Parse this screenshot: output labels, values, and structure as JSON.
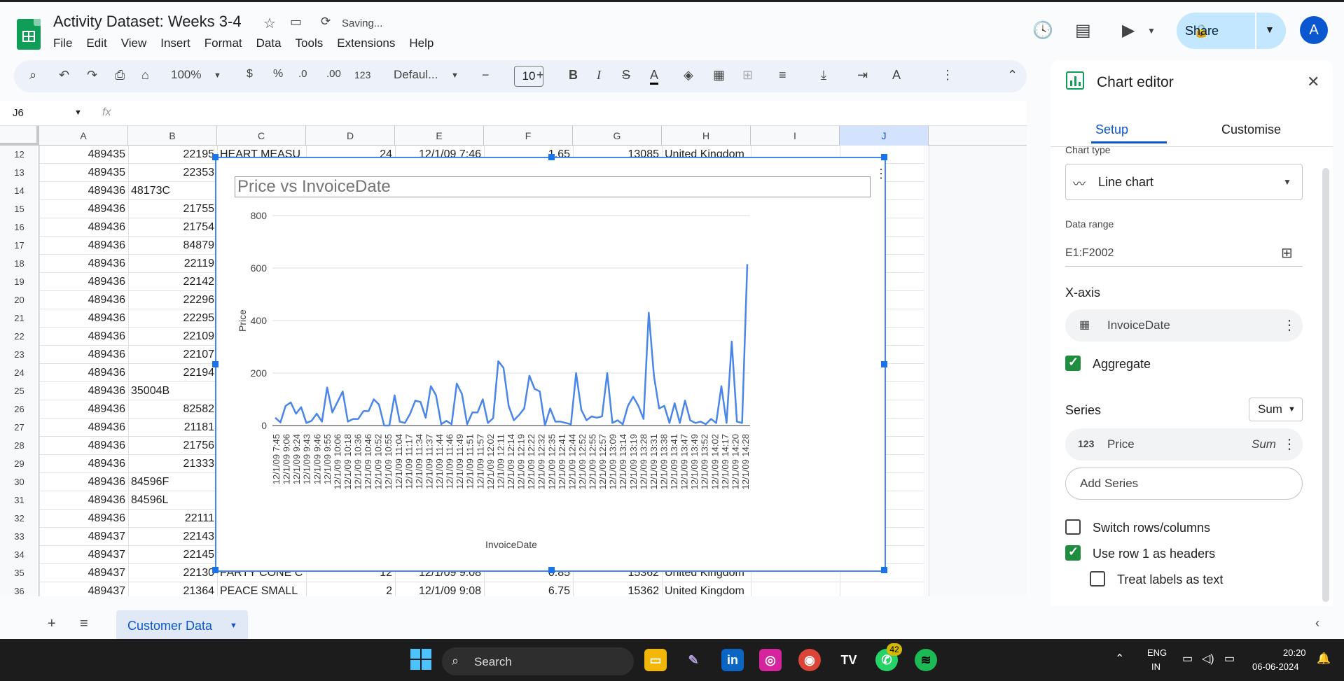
{
  "app": {
    "title": "Activity Dataset: Weeks 3-4",
    "status": "Saving...",
    "menu": [
      "File",
      "Edit",
      "View",
      "Insert",
      "Format",
      "Data",
      "Tools",
      "Extensions",
      "Help"
    ],
    "share_label": "Share",
    "avatar_letter": "A"
  },
  "toolbar": {
    "zoom": "100%",
    "currency": "$",
    "percent": "%",
    "dec_decrease": ".0",
    "dec_increase": ".00",
    "number_format": "123",
    "font": "Defaul...",
    "font_size": "10"
  },
  "formula_bar": {
    "name_box": "J6",
    "fx": "fx"
  },
  "grid": {
    "columns": [
      "A",
      "B",
      "C",
      "D",
      "E",
      "F",
      "G",
      "H",
      "I",
      "J"
    ],
    "rows": [
      {
        "n": "12",
        "a": "489435",
        "b": "22195",
        "c": "HEART MEASU",
        "d": "24",
        "e": "12/1/09 7:46",
        "f": "1.65",
        "g": "13085",
        "h": "United Kingdom"
      },
      {
        "n": "13",
        "a": "489435",
        "b": "22353",
        "c": "",
        "d": "",
        "e": "",
        "f": "",
        "g": "",
        "h": ""
      },
      {
        "n": "14",
        "a": "489436",
        "b": "48173C",
        "c": "",
        "d": "",
        "e": "",
        "f": "",
        "g": "",
        "h": ""
      },
      {
        "n": "15",
        "a": "489436",
        "b": "21755",
        "c": "",
        "d": "",
        "e": "",
        "f": "",
        "g": "",
        "h": ""
      },
      {
        "n": "16",
        "a": "489436",
        "b": "21754",
        "c": "",
        "d": "",
        "e": "",
        "f": "",
        "g": "",
        "h": ""
      },
      {
        "n": "17",
        "a": "489436",
        "b": "84879",
        "c": "",
        "d": "",
        "e": "",
        "f": "",
        "g": "",
        "h": ""
      },
      {
        "n": "18",
        "a": "489436",
        "b": "22119",
        "c": "",
        "d": "",
        "e": "",
        "f": "",
        "g": "",
        "h": ""
      },
      {
        "n": "19",
        "a": "489436",
        "b": "22142",
        "c": "",
        "d": "",
        "e": "",
        "f": "",
        "g": "",
        "h": ""
      },
      {
        "n": "20",
        "a": "489436",
        "b": "22296",
        "c": "",
        "d": "",
        "e": "",
        "f": "",
        "g": "",
        "h": ""
      },
      {
        "n": "21",
        "a": "489436",
        "b": "22295",
        "c": "",
        "d": "",
        "e": "",
        "f": "",
        "g": "",
        "h": ""
      },
      {
        "n": "22",
        "a": "489436",
        "b": "22109",
        "c": "",
        "d": "",
        "e": "",
        "f": "",
        "g": "",
        "h": ""
      },
      {
        "n": "23",
        "a": "489436",
        "b": "22107",
        "c": "",
        "d": "",
        "e": "",
        "f": "",
        "g": "",
        "h": ""
      },
      {
        "n": "24",
        "a": "489436",
        "b": "22194",
        "c": "",
        "d": "",
        "e": "",
        "f": "",
        "g": "",
        "h": ""
      },
      {
        "n": "25",
        "a": "489436",
        "b": "35004B",
        "c": "",
        "d": "",
        "e": "",
        "f": "",
        "g": "",
        "h": ""
      },
      {
        "n": "26",
        "a": "489436",
        "b": "82582",
        "c": "",
        "d": "",
        "e": "",
        "f": "",
        "g": "",
        "h": ""
      },
      {
        "n": "27",
        "a": "489436",
        "b": "21181",
        "c": "",
        "d": "",
        "e": "",
        "f": "",
        "g": "",
        "h": ""
      },
      {
        "n": "28",
        "a": "489436",
        "b": "21756",
        "c": "",
        "d": "",
        "e": "",
        "f": "",
        "g": "",
        "h": ""
      },
      {
        "n": "29",
        "a": "489436",
        "b": "21333",
        "c": "",
        "d": "",
        "e": "",
        "f": "",
        "g": "",
        "h": ""
      },
      {
        "n": "30",
        "a": "489436",
        "b": "84596F",
        "c": "",
        "d": "",
        "e": "",
        "f": "",
        "g": "",
        "h": ""
      },
      {
        "n": "31",
        "a": "489436",
        "b": "84596L",
        "c": "",
        "d": "",
        "e": "",
        "f": "",
        "g": "",
        "h": ""
      },
      {
        "n": "32",
        "a": "489436",
        "b": "22111",
        "c": "",
        "d": "",
        "e": "",
        "f": "",
        "g": "",
        "h": ""
      },
      {
        "n": "33",
        "a": "489437",
        "b": "22143",
        "c": "",
        "d": "",
        "e": "",
        "f": "",
        "g": "",
        "h": ""
      },
      {
        "n": "34",
        "a": "489437",
        "b": "22145",
        "c": "",
        "d": "",
        "e": "",
        "f": "",
        "g": "",
        "h": ""
      },
      {
        "n": "35",
        "a": "489437",
        "b": "22130",
        "c": "PARTY CONE C",
        "d": "12",
        "e": "12/1/09 9:08",
        "f": "0.85",
        "g": "15362",
        "h": "United Kingdom"
      },
      {
        "n": "36",
        "a": "489437",
        "b": "21364",
        "c": "PEACE SMALL",
        "d": "2",
        "e": "12/1/09 9:08",
        "f": "6.75",
        "g": "15362",
        "h": "United Kingdom"
      }
    ]
  },
  "chart_data": {
    "type": "line",
    "title": "Price vs InvoiceDate",
    "xlabel": "InvoiceDate",
    "ylabel": "Price",
    "ylim": [
      0,
      800
    ],
    "yticks": [
      "0",
      "200",
      "400",
      "600",
      "800"
    ],
    "color": "#4a86e8",
    "grid": true,
    "tick_labels": [
      "12/1/09 7:45",
      "12/1/09 9:06",
      "12/1/09 9:24",
      "12/1/09 9:43",
      "12/1/09 9:46",
      "12/1/09 9:55",
      "12/1/09 10:06",
      "12/1/09 10:18",
      "12/1/09 10:36",
      "12/1/09 10:46",
      "12/1/09 10:52",
      "12/1/09 10:55",
      "12/1/09 11:04",
      "12/1/09 11:17",
      "12/1/09 11:34",
      "12/1/09 11:37",
      "12/1/09 11:44",
      "12/1/09 11:46",
      "12/1/09 11:49",
      "12/1/09 11:51",
      "12/1/09 11:57",
      "12/1/09 12:02",
      "12/1/09 12:11",
      "12/1/09 12:14",
      "12/1/09 12:19",
      "12/1/09 12:22",
      "12/1/09 12:32",
      "12/1/09 12:35",
      "12/1/09 12:41",
      "12/1/09 12:44",
      "12/1/09 12:52",
      "12/1/09 12:55",
      "12/1/09 12:57",
      "12/1/09 13:09",
      "12/1/09 13:14",
      "12/1/09 13:19",
      "12/1/09 13:28",
      "12/1/09 13:31",
      "12/1/09 13:38",
      "12/1/09 13:41",
      "12/1/09 13:47",
      "12/1/09 13:49",
      "12/1/09 13:52",
      "12/1/09 14:02",
      "12/1/09 14:17",
      "12/1/09 14:20",
      "12/1/09 14:28"
    ],
    "series": [
      {
        "values": [
          30,
          12,
          75,
          88,
          45,
          70,
          10,
          18,
          45,
          15,
          145,
          50,
          90,
          130,
          15,
          25,
          25,
          55,
          55,
          100,
          80,
          0,
          0,
          115,
          15,
          10,
          45,
          95,
          90,
          30,
          150,
          115,
          5,
          18,
          5,
          160,
          120,
          5,
          50,
          50,
          100,
          10,
          28,
          245,
          220,
          75,
          20,
          40,
          65,
          190,
          140,
          130,
          0,
          65,
          15,
          15,
          10,
          5,
          200,
          60,
          20,
          35,
          30,
          35,
          200,
          10,
          20,
          5,
          75,
          110,
          75,
          25,
          430,
          190,
          65,
          75,
          10,
          85,
          10,
          95,
          20,
          10,
          15,
          5,
          25,
          10,
          150,
          10,
          320,
          15,
          10,
          615
        ]
      }
    ]
  },
  "sidebar": {
    "title": "Chart editor",
    "tab_setup": "Setup",
    "tab_customise": "Customise",
    "chart_type_label": "Chart type",
    "chart_type": "Line chart",
    "data_range_label": "Data range",
    "data_range": "E1:F2002",
    "xaxis_label": "X-axis",
    "xaxis_value": "InvoiceDate",
    "aggregate": "Aggregate",
    "series_label": "Series",
    "series_agg": "Sum",
    "series_name": "Price",
    "series_sum": "Sum",
    "series_icon": "123",
    "add_series": "Add Series",
    "switch_rows": "Switch rows/columns",
    "use_row1": "Use row 1 as headers",
    "treat_labels": "Treat labels as text"
  },
  "sheet_tab": "Customer Data",
  "taskbar": {
    "search": "Search",
    "lang": "ENG",
    "region": "IN",
    "time": "20:20",
    "date": "06-06-2024",
    "whatsapp_badge": "42"
  }
}
